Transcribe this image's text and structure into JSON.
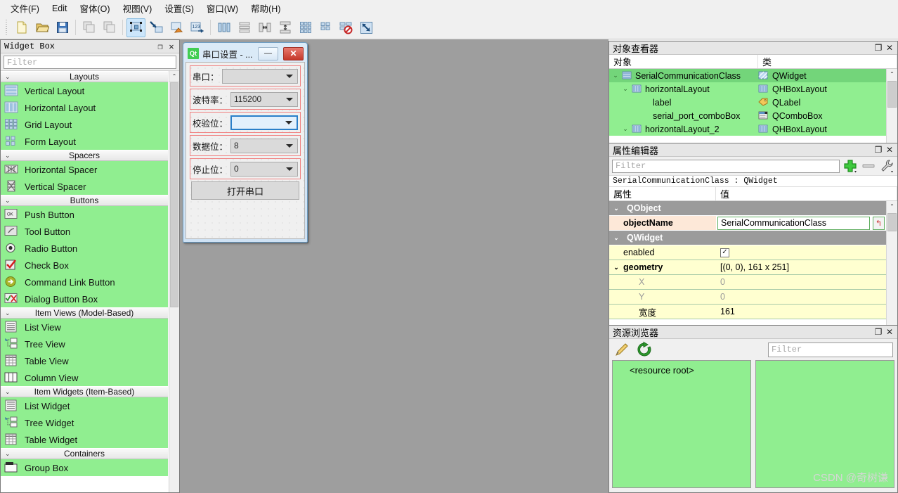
{
  "menu": {
    "items": [
      {
        "label": "文件(F)",
        "name": "menu-file"
      },
      {
        "label": "Edit",
        "name": "menu-edit"
      },
      {
        "label": "窗体(O)",
        "name": "menu-form"
      },
      {
        "label": "视图(V)",
        "name": "menu-view"
      },
      {
        "label": "设置(S)",
        "name": "menu-settings"
      },
      {
        "label": "窗口(W)",
        "name": "menu-window"
      },
      {
        "label": "帮助(H)",
        "name": "menu-help"
      }
    ]
  },
  "toolbar": {
    "buttons": [
      {
        "icon": "new-file-icon",
        "name": "new-form-button",
        "active": false
      },
      {
        "icon": "open-folder-icon",
        "name": "open-form-button",
        "active": false
      },
      {
        "icon": "save-disk-icon",
        "name": "save-form-button",
        "active": false
      },
      {
        "icon": "undo-icon",
        "name": "undo-button",
        "active": false
      },
      {
        "icon": "redo-icon",
        "name": "redo-button",
        "active": false
      },
      {
        "icon": "edit-widgets-icon",
        "name": "edit-widgets-button",
        "active": true
      },
      {
        "icon": "edit-signals-slots-icon",
        "name": "edit-signals-slots-button",
        "active": false
      },
      {
        "icon": "edit-buddies-icon",
        "name": "edit-buddies-button",
        "active": false
      },
      {
        "icon": "edit-tab-order-icon",
        "name": "edit-tab-order-button",
        "active": false
      },
      {
        "icon": "layout-horizontal-icon",
        "name": "layout-horizontally-button",
        "active": false
      },
      {
        "icon": "layout-vertical-icon",
        "name": "layout-vertically-button",
        "active": false
      },
      {
        "icon": "layout-splitter-h-icon",
        "name": "layout-splitter-horizontal-button",
        "active": false
      },
      {
        "icon": "layout-splitter-v-icon",
        "name": "layout-splitter-vertical-button",
        "active": false
      },
      {
        "icon": "layout-grid-icon",
        "name": "layout-grid-button",
        "active": false
      },
      {
        "icon": "layout-form-icon",
        "name": "layout-form-button",
        "active": false
      },
      {
        "icon": "break-layout-icon",
        "name": "break-layout-button",
        "active": false
      },
      {
        "icon": "adjust-size-icon",
        "name": "adjust-size-button",
        "active": false
      }
    ]
  },
  "widget_box": {
    "title": "Widget Box",
    "filter_placeholder": "Filter",
    "groups": [
      {
        "label": "Layouts",
        "items": [
          {
            "label": "Vertical Layout",
            "icon": "vertical-layout-icon"
          },
          {
            "label": "Horizontal Layout",
            "icon": "horizontal-layout-icon"
          },
          {
            "label": "Grid Layout",
            "icon": "grid-layout-icon"
          },
          {
            "label": "Form Layout",
            "icon": "form-layout-icon"
          }
        ]
      },
      {
        "label": "Spacers",
        "items": [
          {
            "label": "Horizontal Spacer",
            "icon": "horizontal-spacer-icon"
          },
          {
            "label": "Vertical Spacer",
            "icon": "vertical-spacer-icon"
          }
        ]
      },
      {
        "label": "Buttons",
        "items": [
          {
            "label": "Push Button",
            "icon": "push-button-icon"
          },
          {
            "label": "Tool Button",
            "icon": "tool-button-icon"
          },
          {
            "label": "Radio Button",
            "icon": "radio-button-icon"
          },
          {
            "label": "Check Box",
            "icon": "check-box-icon"
          },
          {
            "label": "Command Link Button",
            "icon": "command-link-button-icon"
          },
          {
            "label": "Dialog Button Box",
            "icon": "dialog-button-box-icon"
          }
        ]
      },
      {
        "label": "Item Views (Model-Based)",
        "items": [
          {
            "label": "List View",
            "icon": "list-view-icon"
          },
          {
            "label": "Tree View",
            "icon": "tree-view-icon"
          },
          {
            "label": "Table View",
            "icon": "table-view-icon"
          },
          {
            "label": "Column View",
            "icon": "column-view-icon"
          }
        ]
      },
      {
        "label": "Item Widgets (Item-Based)",
        "items": [
          {
            "label": "List Widget",
            "icon": "list-widget-icon"
          },
          {
            "label": "Tree Widget",
            "icon": "tree-widget-icon"
          },
          {
            "label": "Table Widget",
            "icon": "table-widget-icon"
          }
        ]
      },
      {
        "label": "Containers",
        "items": [
          {
            "label": "Group Box",
            "icon": "group-box-icon"
          }
        ]
      }
    ]
  },
  "dialog": {
    "logo_text": "Qt",
    "title": "串口设置 - ...",
    "minimize_label": "—",
    "close_label": "✕",
    "rows": [
      {
        "label": "串口：",
        "value": "",
        "selected": false,
        "name": "serial-port-combobox"
      },
      {
        "label": "波特率：",
        "value": "115200",
        "selected": false,
        "name": "baud-rate-combobox"
      },
      {
        "label": "校验位：",
        "value": "",
        "selected": true,
        "name": "parity-combobox"
      },
      {
        "label": "数据位：",
        "value": "8",
        "selected": false,
        "name": "data-bits-combobox"
      },
      {
        "label": "停止位：",
        "value": "0",
        "selected": false,
        "name": "stop-bits-combobox"
      }
    ],
    "open_button": "打开串口"
  },
  "object_inspector": {
    "title": "对象查看器",
    "columns": [
      "对象",
      "类"
    ],
    "rows": [
      {
        "object": "SerialCommunicationClass",
        "class": "QWidget",
        "indent": 0,
        "expanded": true,
        "selected": true,
        "icon": "widget-icon",
        "class_icon": "qwidget-icon"
      },
      {
        "object": "horizontalLayout",
        "class": "QHBoxLayout",
        "indent": 1,
        "expanded": true,
        "selected": false,
        "icon": "hbox-icon",
        "class_icon": "hbox-icon"
      },
      {
        "object": "label",
        "class": "QLabel",
        "indent": 2,
        "expanded": null,
        "selected": false,
        "icon": "",
        "class_icon": "qlabel-icon"
      },
      {
        "object": "serial_port_comboBox",
        "class": "QComboBox",
        "indent": 2,
        "expanded": null,
        "selected": false,
        "icon": "",
        "class_icon": "qcombobox-icon"
      },
      {
        "object": "horizontalLayout_2",
        "class": "QHBoxLayout",
        "indent": 1,
        "expanded": true,
        "selected": false,
        "icon": "hbox-icon",
        "class_icon": "hbox-icon"
      }
    ]
  },
  "property_editor": {
    "title": "属性编辑器",
    "filter_placeholder": "Filter",
    "object_line": "SerialCommunicationClass : QWidget",
    "columns": [
      "属性",
      "值"
    ],
    "rows": [
      {
        "kind": "group",
        "key": "QObject",
        "value": ""
      },
      {
        "kind": "prop-input",
        "key": "objectName",
        "value": "SerialCommunicationClass",
        "bold": true
      },
      {
        "kind": "group",
        "key": "QWidget",
        "value": ""
      },
      {
        "kind": "prop-check",
        "key": "enabled",
        "value": "✓"
      },
      {
        "kind": "prop",
        "key": "geometry",
        "value": "[(0, 0), 161 x 251]",
        "bold": true,
        "expanded": true
      },
      {
        "kind": "sub",
        "key": "X",
        "value": "0"
      },
      {
        "kind": "sub",
        "key": "Y",
        "value": "0"
      },
      {
        "kind": "sub-dark",
        "key": "宽度",
        "value": "161"
      }
    ]
  },
  "resource_browser": {
    "title": "资源浏览器",
    "edit_icon": "pencil-icon",
    "reload_icon": "reload-icon",
    "filter_placeholder": "Filter",
    "root_label": "<resource root>",
    "watermark": "CSDN @奇树谦"
  },
  "dock_buttons": {
    "float": "❐",
    "close": "✕"
  }
}
